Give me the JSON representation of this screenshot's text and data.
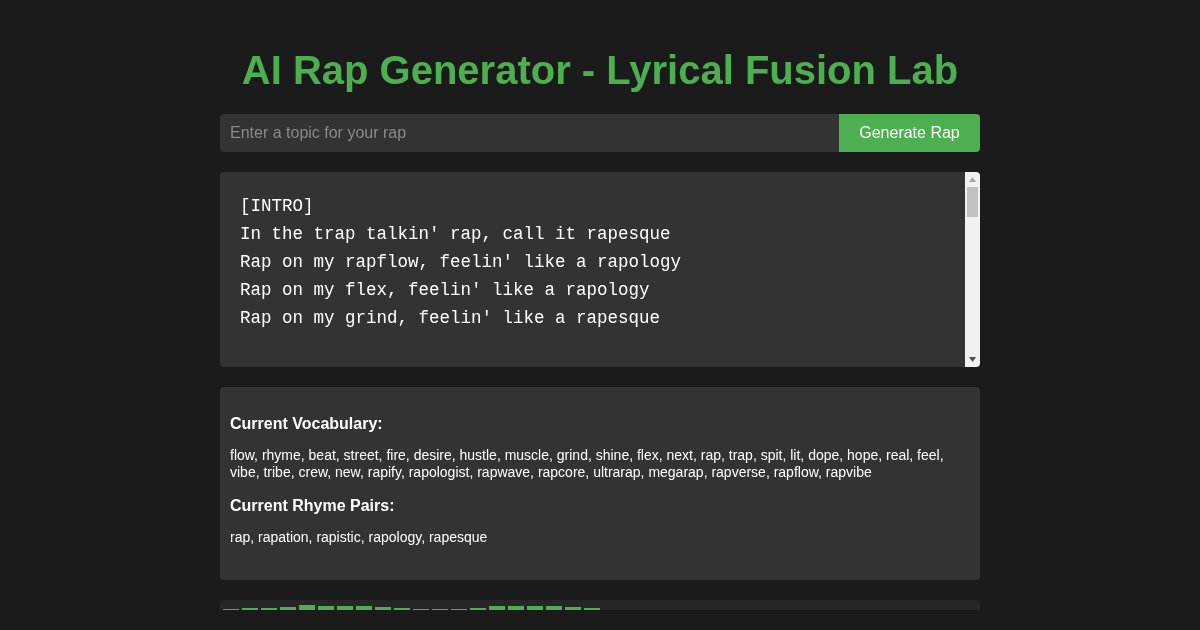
{
  "title": "AI Rap Generator - Lyrical Fusion Lab",
  "topic_input": {
    "placeholder": "Enter a topic for your rap"
  },
  "generate_button": "Generate Rap",
  "lyrics": [
    "[INTRO]",
    "In the trap talkin' rap, call it rapesque",
    "Rap on my rapflow, feelin' like a rapology",
    "Rap on my flex, feelin' like a rapology",
    "Rap on my grind, feelin' like a rapesque"
  ],
  "info": [
    {
      "heading": "Current Vocabulary:",
      "text": "flow, rhyme, beat, street, fire, desire, hustle, muscle, grind, shine, flex, next, rap, trap, spit, lit, dope, hope, real, feel, vibe, tribe, crew, new, rapify, rapologist, rapwave, rapcore, ultrarap, megarap, rapverse, rapflow, rapvibe"
    },
    {
      "heading": "Current Rhyme Pairs:",
      "text": "rap, rapation, rapistic, rapology, rapesque"
    }
  ]
}
